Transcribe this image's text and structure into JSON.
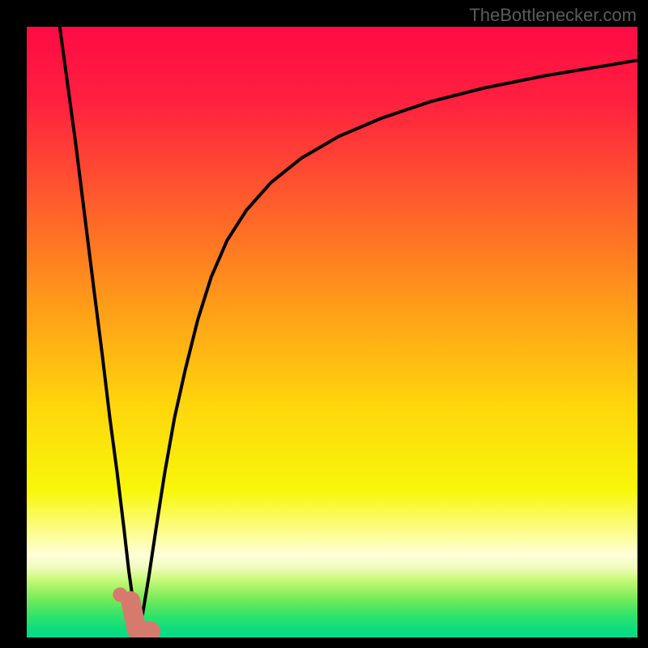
{
  "attribution": "TheBottlenecker.com",
  "colors": {
    "bg_black": "#000000",
    "gradient_stops": [
      {
        "offset": 0.0,
        "color": "#ff0b44"
      },
      {
        "offset": 0.12,
        "color": "#ff2040"
      },
      {
        "offset": 0.28,
        "color": "#ff5a2c"
      },
      {
        "offset": 0.45,
        "color": "#ff9a19"
      },
      {
        "offset": 0.62,
        "color": "#ffd60c"
      },
      {
        "offset": 0.76,
        "color": "#f7f70a"
      },
      {
        "offset": 0.845,
        "color": "#fdfeb0"
      },
      {
        "offset": 0.865,
        "color": "#fefed8"
      },
      {
        "offset": 0.885,
        "color": "#f0fbc0"
      },
      {
        "offset": 0.905,
        "color": "#c9f978"
      },
      {
        "offset": 0.935,
        "color": "#7bec57"
      },
      {
        "offset": 0.965,
        "color": "#2ee36a"
      },
      {
        "offset": 0.985,
        "color": "#0fdd7d"
      },
      {
        "offset": 1.0,
        "color": "#07d98a"
      }
    ],
    "curve": "#000000",
    "marker_fill": "#d77a6e",
    "marker_stroke": "#d77a6e"
  },
  "chart_data": {
    "type": "line",
    "title": "",
    "xlabel": "",
    "ylabel": "",
    "xlim": [
      0,
      100
    ],
    "ylim": [
      0,
      100
    ],
    "series": [
      {
        "name": "bottleneck-curve-left",
        "x": [
          5.4,
          6.5,
          8.0,
          9.5,
          11.0,
          12.4,
          13.6,
          14.8,
          15.9,
          16.7,
          17.4,
          17.9,
          18.2
        ],
        "y": [
          100,
          92,
          81,
          69,
          57,
          46,
          36,
          27,
          18,
          11,
          6,
          2.5,
          0.7
        ]
      },
      {
        "name": "bottleneck-curve-right",
        "x": [
          18.2,
          19.0,
          20.0,
          21.2,
          22.6,
          24.2,
          26.0,
          28.0,
          30.2,
          32.8,
          36.0,
          40.0,
          45.0,
          51.0,
          58.0,
          66.0,
          75.0,
          85.0,
          100.0
        ],
        "y": [
          0.7,
          4,
          10,
          18,
          27,
          36,
          44,
          52,
          59,
          65,
          70,
          74.5,
          78.5,
          82,
          85,
          87.7,
          90,
          92,
          94.5
        ]
      }
    ],
    "markers": [
      {
        "name": "dot",
        "x": 15.3,
        "y": 7.0
      },
      {
        "name": "j-stroke-start",
        "x": 17.0,
        "y": 6.0
      },
      {
        "name": "j-stroke-bottom",
        "x": 18.0,
        "y": 1.3
      },
      {
        "name": "j-stroke-end",
        "x": 20.3,
        "y": 1.0
      }
    ],
    "grid": false,
    "legend": false
  }
}
